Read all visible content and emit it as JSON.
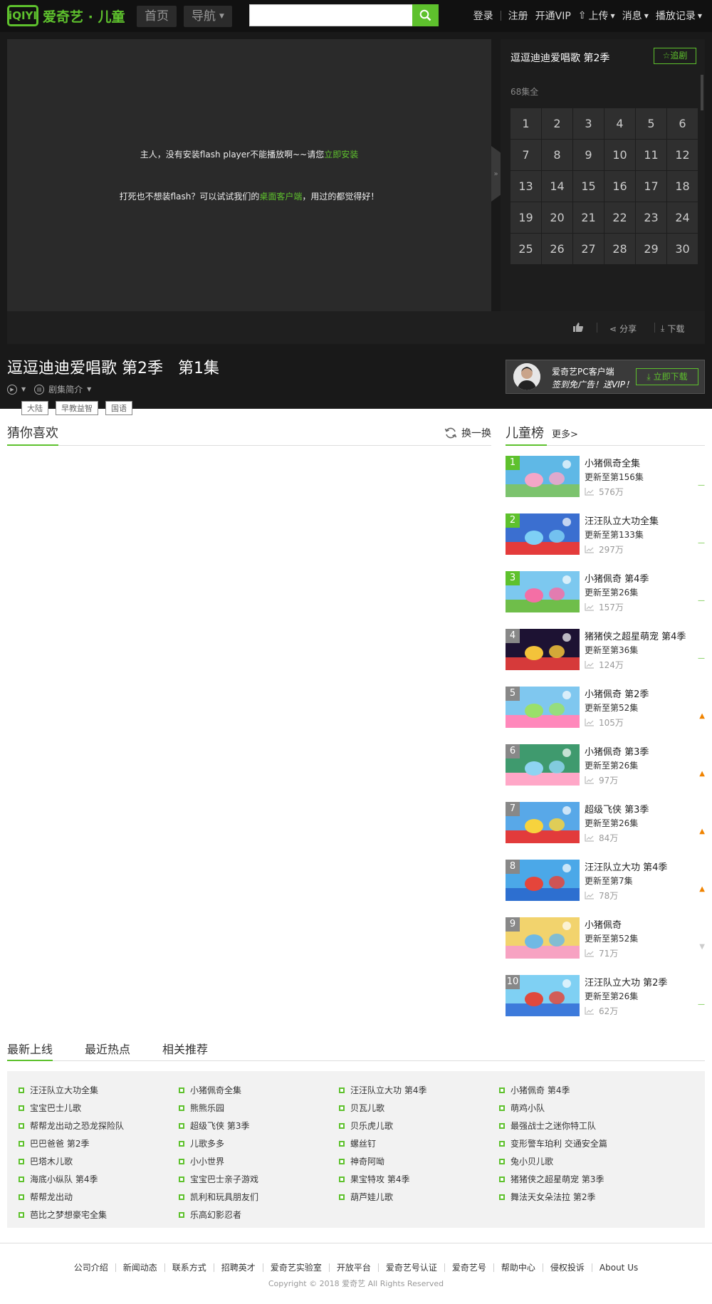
{
  "header": {
    "logo_mark": "iQIYI",
    "logo_text": "爱奇艺 · 儿童",
    "home": "首页",
    "nav": "导航",
    "search_placeholder": "",
    "links": [
      "登录",
      "注册",
      "开通VIP",
      "上传",
      "消息",
      "播放记录"
    ]
  },
  "player": {
    "msg1_a": "主人，没有安装flash player不能播放啊~~请您",
    "msg1_link": "立即安装",
    "msg2_a": "打死也不想装flash？可以试试我们的",
    "msg2_link": "桌面客户端",
    "msg2_b": "，用过的都觉得好！",
    "toggle": "»"
  },
  "side": {
    "title": "逗逗迪迪爱唱歌 第2季",
    "follow": "追剧",
    "ep_count": "68集全",
    "episodes": [
      "1",
      "2",
      "3",
      "4",
      "5",
      "6",
      "7",
      "8",
      "9",
      "10",
      "11",
      "12",
      "13",
      "14",
      "15",
      "16",
      "17",
      "18",
      "19",
      "20",
      "21",
      "22",
      "23",
      "24",
      "25",
      "26",
      "27",
      "28",
      "29",
      "30"
    ]
  },
  "controls": {
    "share": "分享",
    "download": "下载"
  },
  "episode": {
    "heading": "逗逗迪迪爱唱歌 第2季   第1集",
    "intro": "剧集简介",
    "tags": [
      "大陆",
      "早教益智",
      "国语"
    ]
  },
  "pc_ad": {
    "line1": "爱奇艺PC客户端",
    "line2": "签到免广告！送VIP！",
    "download": "立即下载"
  },
  "recommend": {
    "title": "猜你喜欢",
    "refresh": "换一换"
  },
  "chart": {
    "title": "儿童榜",
    "more": "更多>",
    "items": [
      {
        "rank": "1",
        "title": "小猪佩奇全集",
        "update": "更新至第156集",
        "views": "576万",
        "trend": "flat"
      },
      {
        "rank": "2",
        "title": "汪汪队立大功全集",
        "update": "更新至第133集",
        "views": "297万",
        "trend": "flat"
      },
      {
        "rank": "3",
        "title": "小猪佩奇 第4季",
        "update": "更新至第26集",
        "views": "157万",
        "trend": "flat"
      },
      {
        "rank": "4",
        "title": "猪猪侠之超星萌宠 第4季",
        "update": "更新至第36集",
        "views": "124万",
        "trend": "flat"
      },
      {
        "rank": "5",
        "title": "小猪佩奇 第2季",
        "update": "更新至第52集",
        "views": "105万",
        "trend": "up"
      },
      {
        "rank": "6",
        "title": "小猪佩奇 第3季",
        "update": "更新至第26集",
        "views": "97万",
        "trend": "up"
      },
      {
        "rank": "7",
        "title": "超级飞侠 第3季",
        "update": "更新至第26集",
        "views": "84万",
        "trend": "up"
      },
      {
        "rank": "8",
        "title": "汪汪队立大功 第4季",
        "update": "更新至第7集",
        "views": "78万",
        "trend": "up"
      },
      {
        "rank": "9",
        "title": "小猪佩奇",
        "update": "更新至第52集",
        "views": "71万",
        "trend": "down"
      },
      {
        "rank": "10",
        "title": "汪汪队立大功 第2季",
        "update": "更新至第26集",
        "views": "62万",
        "trend": "flat"
      }
    ]
  },
  "tabs": [
    "最新上线",
    "最近热点",
    "相关推荐"
  ],
  "list": [
    [
      "汪汪队立大功全集",
      "宝宝巴士儿歌",
      "帮帮龙出动之恐龙探险队",
      "巴巴爸爸 第2季",
      "巴塔木儿歌",
      "海底小纵队 第4季",
      "帮帮龙出动",
      "芭比之梦想豪宅全集"
    ],
    [
      "小猪佩奇全集",
      "熊熊乐园",
      "超级飞侠 第3季",
      "儿歌多多",
      "小小世界",
      "宝宝巴士亲子游戏",
      "凯利和玩具朋友们",
      "乐高幻影忍者"
    ],
    [
      "汪汪队立大功 第4季",
      "贝瓦儿歌",
      "贝乐虎儿歌",
      "螺丝钉",
      "神奇阿呦",
      "果宝特攻 第4季",
      "葫芦娃儿歌"
    ],
    [
      "小猪佩奇 第4季",
      "萌鸡小队",
      "最强战士之迷你特工队",
      "变形警车珀利 交通安全篇",
      "兔小贝儿歌",
      "猪猪侠之超星萌宠 第3季",
      "舞法天女朵法拉 第2季"
    ]
  ],
  "footer": {
    "links": [
      "公司介绍",
      "新闻动态",
      "联系方式",
      "招聘英才",
      "爱奇艺实验室",
      "开放平台",
      "爱奇艺号认证",
      "爱奇艺号",
      "帮助中心",
      "侵权投诉",
      "About Us"
    ],
    "copyright": "Copyright © 2018 爱奇艺 All Rights Reserved"
  },
  "colors": {
    "accent": "#5ec12d",
    "dark_bg": "#191919",
    "trend_up": "#f08300"
  }
}
